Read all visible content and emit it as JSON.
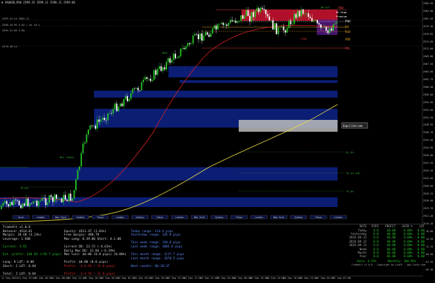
{
  "header": {
    "symbol_line": "▼ XAUUSD,M30  2599.35 2599.11 2598.11 2599.06"
  },
  "left_labels": [
    "2599.24 h4 2603.12",
    "2598.10 M1 5.63 / ex 18 s",
    "2595.51 M4 5.60",
    "2578.50 h4"
  ],
  "zones": {
    "pdh": "PDH",
    "nyr_high": "NY.High",
    "premium": "Premium",
    "eq_label": "EQ",
    "pwh": "PWH",
    "pwl_label": "PWL",
    "dol": "DoD",
    "pdl": "PDL",
    "pdo": "PDO",
    "equilibrium": "Equilibrium",
    "cisd": "CISD",
    "dm_bs": "DM B/S"
  },
  "levels": {
    "lvl_618": "61.8%",
    "lvl_705": "70.5%  OTE",
    "lvl_79": "79.0%",
    "bsl_taken": "BSL Taken",
    "vlow": "W.Low",
    "rbos": "+BoS"
  },
  "sessions": [
    "Asia",
    "London",
    "New York",
    "Sydney",
    "Tokyo",
    "London",
    "Sydney",
    "Tokyo",
    "London",
    "New York",
    "Sydney",
    "Tokyo",
    "London",
    "New York",
    "Sydney",
    "Tokyo",
    "London"
  ],
  "panel": {
    "col1": [
      "TradeAlt v1.0.8",
      "Balance: $514.01",
      "Margin: 20.68 (3.23%)",
      "Leverage: 1:500",
      "",
      "Current: 3.92",
      "",
      "Ext. profit: $36.02 (+56.7 pips)",
      "",
      "Long: 0    LOT: 0.00",
      "Short: 2   LOT: 0.04",
      "",
      "Total:  2    LOT: 0.04"
    ],
    "col2": [
      "",
      "Equity: $511.47 (3.01%)",
      "Free margin: 490.79",
      "Max Long: 0.39.00  Short: 0.1.00",
      "",
      "Current   DD:  23.72  (-4.61%)",
      "Daily Max DD:  31.84  (-6.19%)",
      "Max loss:  $0.00  (0.0 pips)  (0.00%)",
      "",
      "Profit: $0.00  (0.0 pips)",
      "Profit: -$-4.54  (-11.0 pips)",
      "",
      "Profit: -$-4.54  (-11.0 pips)"
    ],
    "col3": [
      "",
      "Today range:           114.4 pips",
      "Yesterday range:       145.8 pips",
      "",
      "This week range:        150.8 pips",
      "Last week range:      1005.8 pips",
      "",
      "This month range:     1117.7 pips",
      "Last month range:     1678.5 pips",
      "",
      "Next candle:          00:20:37"
    ]
  },
  "stats": {
    "headers": [
      "DATE",
      "PIPS",
      "PROFIT",
      "GAIN %",
      "LOT"
    ],
    "rows": [
      [
        "Today",
        "0.0",
        "$0.00",
        "0.00%",
        "0.00"
      ],
      [
        "Yesterday",
        "0.0",
        "$0.00",
        "0.00%",
        "0.00"
      ],
      [
        "2024.09.13",
        "0.0",
        "$0.00",
        "0.00%",
        "0.00"
      ],
      [
        "2024.09.12",
        "0.0",
        "$0.00",
        "0.00%",
        "0.00"
      ],
      [
        "2024.09.11",
        "0.0",
        "$0.00",
        "0.00%",
        "0.00"
      ],
      [
        "Week",
        "0.0",
        "$0.00",
        "0.00%",
        "0.00"
      ],
      [
        "Month",
        "0.0",
        "$0.00",
        "0.00%",
        "0.00"
      ],
      [
        "Year",
        "0.0",
        "$0.00",
        "0.00%",
        "0.00"
      ]
    ],
    "footer_left": "Gain: 4.55%",
    "footer_right": "Monthly: 104.95%",
    "credit": "TradeAlt v1.0.8 - Copyright by LuxFX - www.luxfx.com"
  },
  "time_axis": [
    "11 Sep 2024",
    "11 Sep 23:00",
    "12 Sep 04:00",
    "12 Sep 08:00",
    "12 Sep 12:00",
    "12 Sep 16:00",
    "12 Sep 20:00",
    "13 Sep 01:00",
    "13 Sep 05:00",
    "13 Sep 09:00",
    "13 Sep 13:00",
    "13 Sep 17:00",
    "13 Sep 21:00",
    "16 Sep 02:00",
    "16 Sep 06:00",
    "16 Sep 10:00",
    "16 Sep 14:00",
    "16 Sep 18:00",
    "16 Sep 22:00",
    "17 Sep 03:00",
    "17 Sep 07:00"
  ],
  "price_axis": [
    "2585.95",
    "2583.80",
    "2581.50",
    "2579.26",
    "2576.85",
    "2574.60",
    "2572.00",
    "2569.80",
    "2567.55",
    "2565.00",
    "2562.75",
    "2560.40",
    "2558.00",
    "2555.85",
    "2553.60",
    "2551.20",
    "2548.95",
    "2546.70",
    "2544.40",
    "2542.05",
    "2539.80",
    "2537.45",
    "2535.20",
    "2532.85",
    "2530.60",
    "2528.25",
    "2526.00",
    "2523.70",
    "2521.40",
    "2519.10",
    "2516.80",
    "2514.50",
    "2512.15",
    "2509.90",
    "2507.55",
    "2505.30"
  ],
  "colors": {
    "bull": "#26c926",
    "bear": "#ffffff",
    "ema_red": "#e02020",
    "ema_yellow": "#f0e040",
    "zone_blue": "#0a1d6e",
    "premium_red": "#b0102a",
    "equilibrium_grey": "#bfbfbf"
  }
}
